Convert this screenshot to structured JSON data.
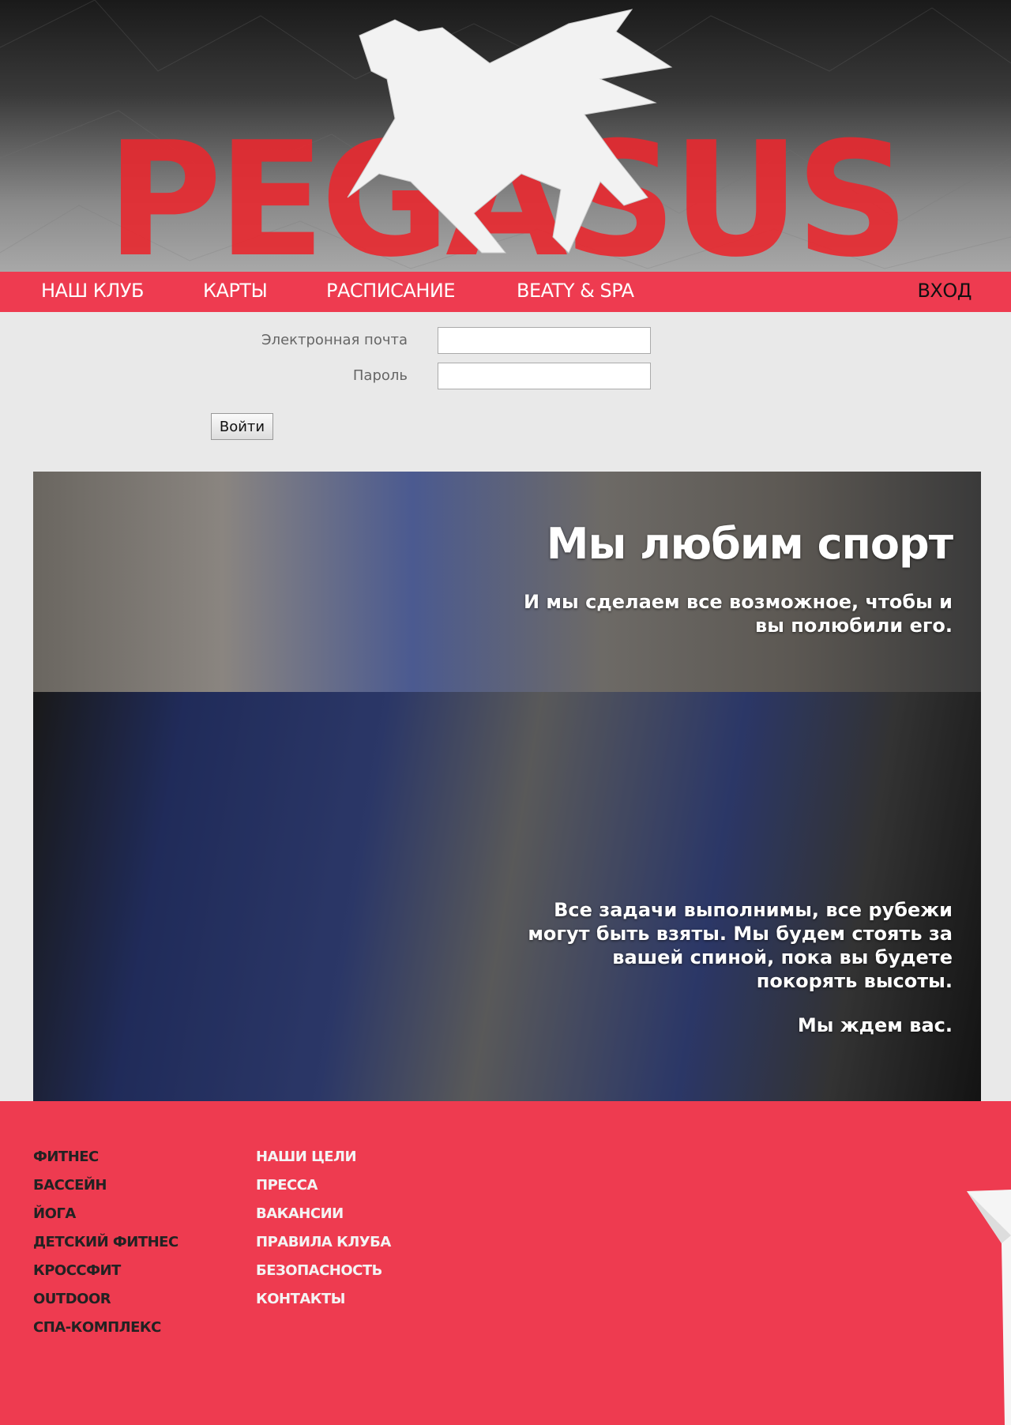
{
  "header": {
    "logo_text": "PEGASUS",
    "brand_color": "#ee3b50"
  },
  "nav": {
    "items": [
      {
        "label": "НАШ КЛУБ"
      },
      {
        "label": "КАРТЫ"
      },
      {
        "label": "РАСПИСАНИЕ"
      },
      {
        "label": "BEATY & SPA"
      }
    ],
    "login": "ВХОД"
  },
  "login_form": {
    "email_label": "Электронная почта",
    "email_value": "",
    "password_label": "Пароль",
    "password_value": "",
    "submit": "Войти"
  },
  "hero": {
    "title": "Мы любим спорт",
    "subtitle": "И мы сделаем все возможное, чтобы и вы полюбили его.",
    "paragraph": "Все задачи выполнимы, все рубежи могут быть взяты. Мы будем стоять за вашей спиной, пока вы будете покорять высоты.",
    "closing": "Мы ждем вас."
  },
  "footer": {
    "col1": [
      "ФИТНЕС",
      "БАССЕЙН",
      "ЙОГА",
      "ДЕТСКИЙ ФИТНЕС",
      "КРОССФИТ",
      "OUTDOOR",
      "СПА-КОМПЛЕКС"
    ],
    "col2": [
      "НАШИ ЦЕЛИ",
      "ПРЕССА",
      "ВАКАНСИИ",
      "ПРАВИЛА КЛУБА",
      "БЕЗОПАСНОСТЬ",
      "КОНТАКТЫ"
    ]
  }
}
